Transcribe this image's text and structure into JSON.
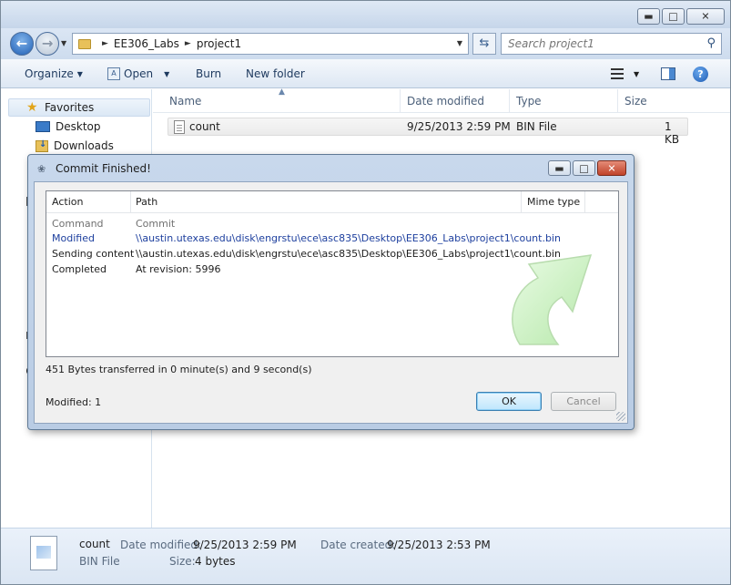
{
  "explorer": {
    "breadcrumb": [
      "EE306_Labs",
      "project1"
    ],
    "search_placeholder": "Search project1",
    "toolbar": {
      "organize": "Organize",
      "open": "Open",
      "burn": "Burn",
      "new_folder": "New folder"
    },
    "nav": {
      "favorites": "Favorites",
      "desktop": "Desktop",
      "downloads": "Downloads"
    },
    "columns": {
      "name": "Name",
      "date": "Date modified",
      "type": "Type",
      "size": "Size"
    },
    "files": [
      {
        "name": "count",
        "date": "9/25/2013 2:59 PM",
        "type": "BIN File",
        "size": "1 KB"
      }
    ],
    "details": {
      "name": "count",
      "type": "BIN File",
      "date_modified_label": "Date modified:",
      "date_modified": "9/25/2013 2:59 PM",
      "date_created_label": "Date created:",
      "date_created": "9/25/2013 2:53 PM",
      "size_label": "Size:",
      "size": "4 bytes"
    }
  },
  "dialog": {
    "title": "Commit Finished!",
    "columns": {
      "action": "Action",
      "path": "Path",
      "mime": "Mime type"
    },
    "rows": [
      {
        "action": "Command",
        "path": "Commit"
      },
      {
        "action": "Modified",
        "path": "\\\\austin.utexas.edu\\disk\\engrstu\\ece\\asc835\\Desktop\\EE306_Labs\\project1\\count.bin"
      },
      {
        "action": "Sending content",
        "path": "\\\\austin.utexas.edu\\disk\\engrstu\\ece\\asc835\\Desktop\\EE306_Labs\\project1\\count.bin"
      },
      {
        "action": "Completed",
        "path": "At revision: 5996"
      }
    ],
    "transfer": "451 Bytes transferred in 0 minute(s) and 9 second(s)",
    "modified": "Modified: 1",
    "ok": "OK",
    "cancel": "Cancel"
  },
  "colors": {
    "modified_row": "#1d3f9e",
    "ok_border": "#3c7fb1",
    "arrow": "#c9f0c0"
  }
}
